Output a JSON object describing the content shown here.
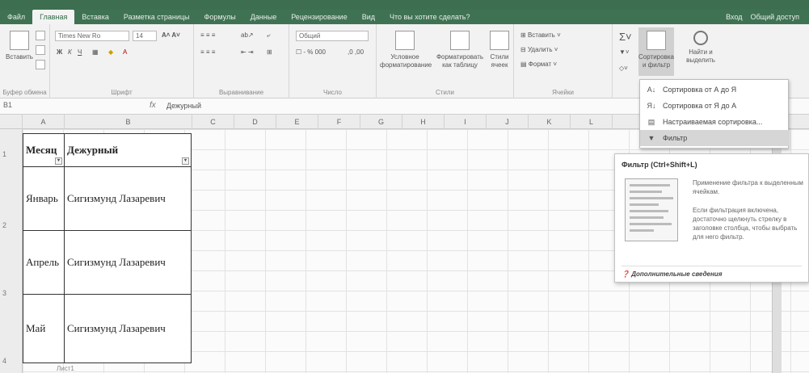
{
  "tabs": [
    "Файл",
    "Главная",
    "Вставка",
    "Разметка страницы",
    "Формулы",
    "Данные",
    "Рецензирование",
    "Вид",
    "Что вы хотите сделать?"
  ],
  "tabs_right": [
    "Вход",
    "Общий доступ"
  ],
  "ribbon": {
    "paste_label": "Вставить",
    "clipboard_label": "Буфер обмена",
    "font_name": "Times New Ro",
    "font_size": "14",
    "font_group_label": "Шрифт",
    "align_group_label": "Выравнивание",
    "number_format": "Общий",
    "number_group_label": "Число",
    "cond_format_label": "Условное форматирование",
    "format_table_label": "Форматировать как таблицу",
    "cell_styles_label": "Стили ячеек",
    "styles_group_label": "Стили",
    "insert_label": "Вставить",
    "delete_label": "Удалить",
    "format_label": "Формат",
    "cells_group_label": "Ячейки",
    "sort_filter_label": "Сортировка и фильтр",
    "find_select_label": "Найти и выделить"
  },
  "formula_bar": {
    "name_box": "B1",
    "fx": "fx",
    "value": "Дежурный"
  },
  "columns": [
    "A",
    "B",
    "C",
    "D",
    "E",
    "F",
    "G",
    "H",
    "I",
    "J",
    "K",
    "L"
  ],
  "rows": [
    "1",
    "2",
    "3",
    "4"
  ],
  "table": {
    "headers": [
      "Месяц",
      "Дежурный"
    ],
    "rows": [
      [
        "Январь",
        "Сигизмунд Лазаревич"
      ],
      [
        "Апрель",
        "Сигизмунд Лазаревич"
      ],
      [
        "Май",
        "Сигизмунд Лазаревич"
      ]
    ]
  },
  "sort_menu": {
    "items": [
      "Сортировка от А до Я",
      "Сортировка от Я до А",
      "Настраиваемая сортировка...",
      "Фильтр"
    ],
    "highlighted": "Фильтр"
  },
  "tooltip": {
    "title": "Фильтр (Ctrl+Shift+L)",
    "text1": "Применение фильтра к выделенным ячейкам.",
    "text2": "Если фильтрация включена, достаточно щелкнуть стрелку в заголовке столбца, чтобы выбрать для него фильтр.",
    "more": "Дополнительные сведения"
  },
  "sheet_tab": "Лист1"
}
